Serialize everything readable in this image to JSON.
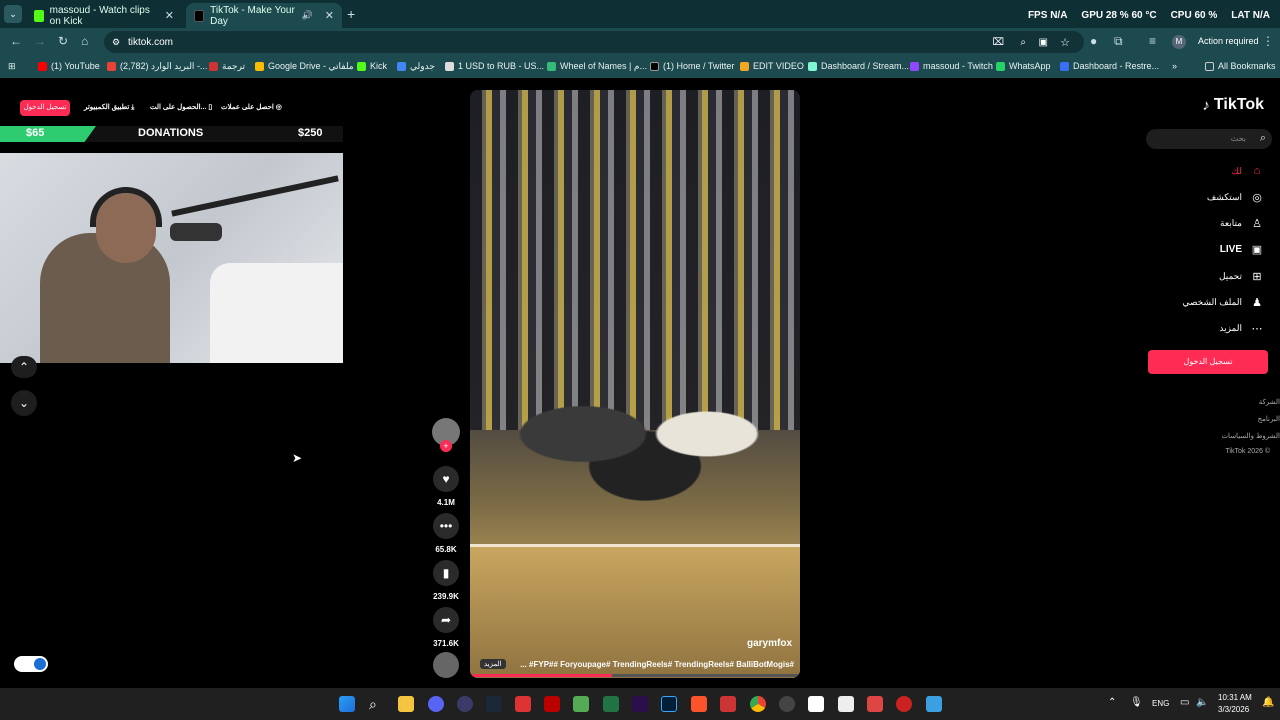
{
  "browser": {
    "tabs": [
      {
        "title": "massoud - Watch clips on Kick"
      },
      {
        "title": "TikTok - Make Your Day"
      }
    ],
    "url": "tiktok.com",
    "action_required": "Action required",
    "avatar_letter": "M",
    "bookmarks": [
      "(1) YouTube",
      "(2,782) البريد الوارد -...",
      "ترجمة",
      "Google Drive - ملفاتي",
      "Kick",
      "جدولي",
      "1 USD to RUB - US...",
      "Wheel of Names | م...",
      "(1) Home / Twitter",
      "EDIT VIDEO",
      "Dashboard / Stream...",
      "massoud - Twitch",
      "WhatsApp",
      "Dashboard - Restre..."
    ],
    "all_bookmarks": "All Bookmarks"
  },
  "overlay_stats": {
    "fps_label": "FPS",
    "fps": "N/A",
    "gpu_label": "GPU",
    "gpu": "28 %",
    "gpu_temp": "60 °C",
    "cpu_label": "CPU",
    "cpu": "60 %",
    "lat_label": "LAT",
    "lat": "N/A"
  },
  "stream_overlay": {
    "goal_current": "$65",
    "goal_title": "DONATIONS",
    "goal_target": "$250",
    "goal_progress": 0.26
  },
  "tiktok": {
    "logo": "TikTok",
    "search_placeholder": "بحث",
    "top_links": [
      "تسجيل الدخول",
      "تطبيق الكمبيوتر",
      "الحصول على الت...",
      "احصل على عملات"
    ],
    "nav": [
      "لك",
      "استكشف",
      "متابعة",
      "LIVE",
      "تحميل",
      "الملف الشخصي",
      "المزيد"
    ],
    "login_button": "تسجيل الدخول",
    "footer": [
      "الشركة",
      "البرنامج",
      "الشروط والسياسات",
      "TikTok 2026 ©"
    ],
    "video": {
      "username": "garymfox",
      "caption": "#FYP## Foryoupage# TrendingReels# TrendingReels# BalliBotMogis# ...",
      "more": "المزيد",
      "progress": 0.43
    },
    "actions": {
      "likes": "4.1M",
      "comments": "65.8K",
      "saves": "239.9K",
      "shares": "371.6K"
    }
  },
  "taskbar": {
    "lang": "ENG",
    "time": "10:31 AM",
    "date": "3/3/2026"
  },
  "colors": {
    "tiktok_red": "#fe2c55",
    "kick_green": "#53fc18",
    "chrome_teal": "#1d4a4f"
  }
}
